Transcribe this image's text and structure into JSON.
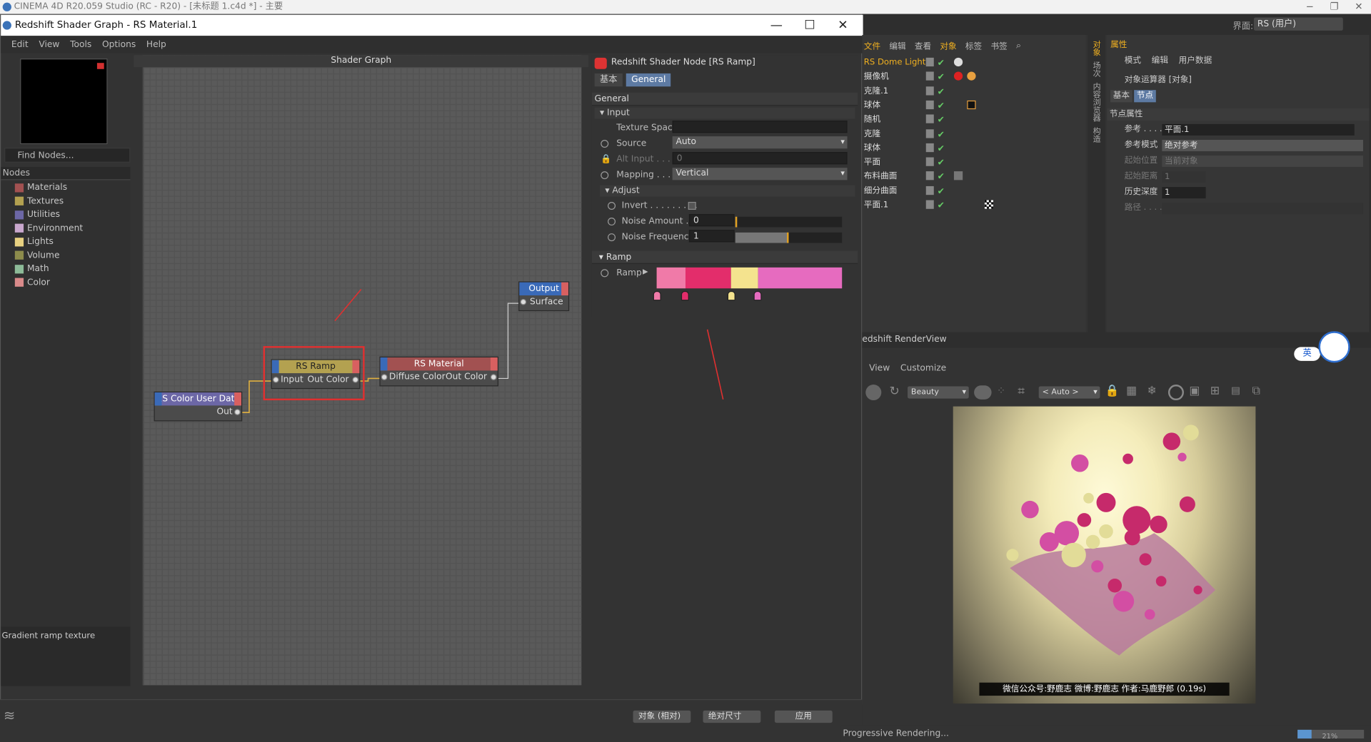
{
  "c4d": {
    "title": "CINEMA 4D R20.059 Studio (RC - R20) - [未标题 1.c4d *] - 主要"
  },
  "interface": {
    "label": "界面:",
    "value": "RS (用户)"
  },
  "shader_graph": {
    "title": "Redshift Shader Graph - RS Material.1",
    "menu": [
      "Edit",
      "View",
      "Tools",
      "Options",
      "Help"
    ],
    "find_placeholder": "Find Nodes...",
    "nodes_header": "Nodes",
    "categories": [
      {
        "label": "Materials",
        "color": "#a25151"
      },
      {
        "label": "Textures",
        "color": "#b3a150"
      },
      {
        "label": "Utilities",
        "color": "#6c67a6"
      },
      {
        "label": "Environment",
        "color": "#c9a7cd"
      },
      {
        "label": "Lights",
        "color": "#e8d181"
      },
      {
        "label": "Volume",
        "color": "#8d8c4c"
      },
      {
        "label": "Math",
        "color": "#8dbb98"
      },
      {
        "label": "Color",
        "color": "#d98a8a"
      }
    ],
    "description": "Gradient ramp texture",
    "canvas_title": "Shader Graph",
    "graph": {
      "color_user_data": {
        "title": "RS Color User Data",
        "out": "Out"
      },
      "ramp": {
        "title": "RS Ramp",
        "input": "Input",
        "out": "Out Color"
      },
      "material": {
        "title": "RS Material",
        "input": "Diffuse Color",
        "out": "Out Color"
      },
      "output": {
        "title": "Output",
        "input": "Surface"
      }
    }
  },
  "props": {
    "title": "Redshift Shader Node [RS Ramp]",
    "tabs": [
      "基本",
      "General"
    ],
    "section_general": "General",
    "group_input": "Input",
    "texture_space": "Texture Space",
    "source_label": "Source",
    "source_value": "Auto",
    "alt_input_label": "Alt Input . . . . .",
    "alt_input_value": "0",
    "mapping_label": "Mapping . . . .",
    "mapping_value": "Vertical",
    "group_adjust": "Adjust",
    "invert_label": "Invert . . . . . . . . .",
    "noise_amount_label": "Noise Amount . .",
    "noise_amount_value": "0",
    "noise_amount_fraction": 0.0,
    "noise_freq_label": "Noise Frequency",
    "noise_freq_value": "1",
    "noise_freq_fraction": 0.5,
    "group_ramp": "Ramp",
    "ramp_label": "Ramp",
    "ramp_stops": [
      {
        "color": "#f07aa8"
      },
      {
        "color": "#e32d6b"
      },
      {
        "color": "#f4e38e"
      },
      {
        "color": "#e66bbf"
      }
    ]
  },
  "object_manager": {
    "tabs": [
      "文件",
      "编辑",
      "查看",
      "对象",
      "标签",
      "书签"
    ],
    "rows": [
      "RS Dome Light",
      "摄像机",
      "克隆.1",
      "球体",
      "随机",
      "克隆",
      "球体",
      "平面",
      "布料曲面",
      "细分曲面",
      "平面.1"
    ]
  },
  "attr_manager": {
    "header": "属性",
    "menu": [
      "模式",
      "编辑",
      "用户数据"
    ],
    "object": "对象运算器 [对象]",
    "tabs": [
      "基本",
      "节点"
    ],
    "section": "节点属性",
    "rows": [
      {
        "label": "参考 . . . . . .",
        "value": "平面.1"
      },
      {
        "label": "参考模式",
        "value": "绝对参考"
      },
      {
        "label": "起始位置",
        "value": "当前对象"
      },
      {
        "label": "起始距离",
        "value": "1"
      },
      {
        "label": "历史深度",
        "value": "1"
      },
      {
        "label": "路径 . . . . . .",
        "value": ""
      }
    ],
    "side_tabs": [
      "对象",
      "场次",
      "内容浏览器",
      "构造"
    ]
  },
  "render_view": {
    "title": "edshift RenderView",
    "menu": [
      "View",
      "Customize"
    ],
    "aov": "Beauty",
    "zoom": "< Auto >",
    "caption": "微信公众号:野鹿志  微博:野鹿志  作者:马鹿野郎  (0.19s)",
    "status": "Progressive Rendering...",
    "progress_text": "21%",
    "progress_fraction": 0.21,
    "badge": "英"
  },
  "bottom": {
    "coord_mode": "对象 (相对)",
    "size_mode": "绝对尺寸",
    "apply": "应用"
  }
}
